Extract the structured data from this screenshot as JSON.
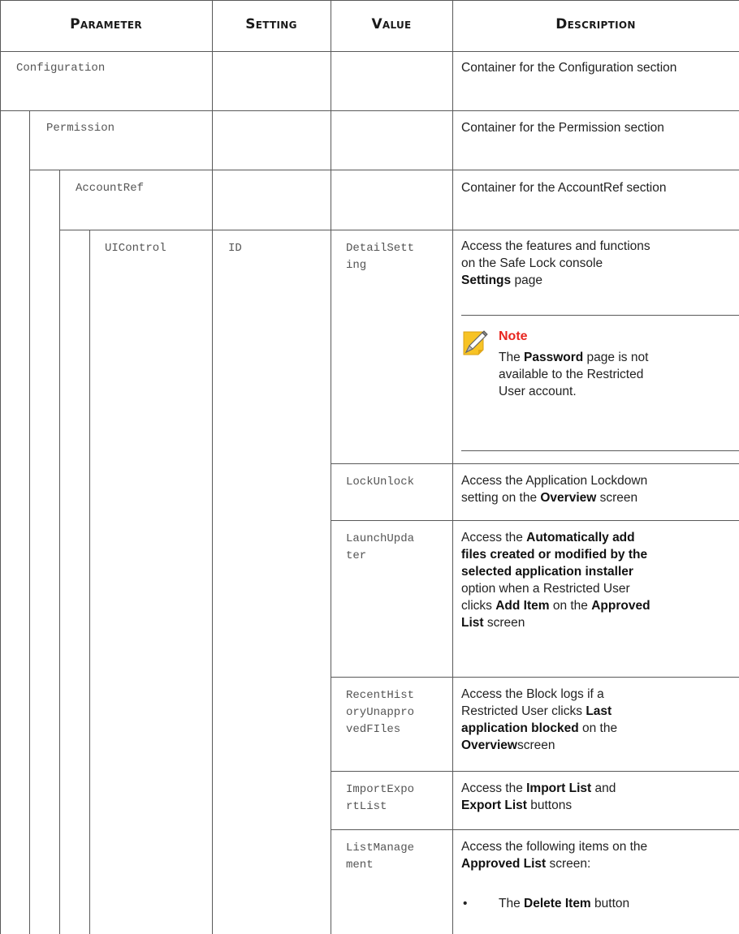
{
  "header": {
    "parameter": "Parameter",
    "setting": "Setting",
    "value": "Value",
    "description": "Description"
  },
  "rows": {
    "configuration": {
      "parameter": "Configuration",
      "description": "Container for the Configuration section"
    },
    "permission": {
      "parameter": "Permission",
      "description": "Container for the Permission section"
    },
    "accountref": {
      "parameter": "AccountRef",
      "description": "Container for the AccountRef section"
    },
    "uicontrol": {
      "parameter": "UIControl",
      "setting": "ID"
    }
  },
  "values": {
    "detail_l1": "DetailSett",
    "detail_l2": "ing",
    "lock": "LockUnlock",
    "launch_l1": "LaunchUpda",
    "launch_l2": "ter",
    "recent_l1": "RecentHist",
    "recent_l2": "oryUnappro",
    "recent_l3": "vedFIles",
    "import_l1": "ImportExpo",
    "import_l2": "rtList",
    "list_l1": "ListManage",
    "list_l2": "ment"
  },
  "desc": {
    "detail": {
      "l1": "Access the features and functions",
      "l2": "on the Safe Lock console",
      "l3_b": "Settings",
      "l3_t": " page"
    },
    "note": {
      "title": "Note",
      "l1_a": "The ",
      "l1_b": "Password",
      "l1_c": " page is not",
      "l2": "available to the Restricted",
      "l3": "User account."
    },
    "lock": {
      "l1": "Access the Application Lockdown",
      "l2_a": "setting on the ",
      "l2_b": "Overview",
      "l2_c": " screen"
    },
    "launch": {
      "l1_a": "Access the ",
      "l1_b": "Automatically add",
      "l2_b": "files created or modified by the",
      "l3_b": "selected application installer",
      "l4": "option when a Restricted User",
      "l5_a": "clicks ",
      "l5_b": "Add Item",
      "l5_c": " on the ",
      "l5_d": "Approved",
      "l6_b": "List",
      "l6_c": " screen"
    },
    "recent": {
      "l1": "Access the Block logs if a",
      "l2_a": "Restricted User clicks ",
      "l2_b": "Last",
      "l3_b": "application blocked",
      "l3_c": " on the",
      "l4_b": "Overview",
      "l4_c": "screen"
    },
    "import": {
      "l1_a": "Access the ",
      "l1_b": "Import List",
      "l1_c": " and",
      "l2_b": "Export List",
      "l2_c": " buttons"
    },
    "list": {
      "l1": "Access the following items on the",
      "l2_b": "Approved List",
      "l2_c": " screen:",
      "bullet": "•",
      "b1_a": "The ",
      "b1_b": "Delete Item",
      "b1_c": " button"
    }
  },
  "colors": {
    "rule": "#595959",
    "note_title": "#e8261f",
    "note_icon_fill": "#f7c325"
  },
  "icons": {
    "note": "note-pencil-icon"
  }
}
